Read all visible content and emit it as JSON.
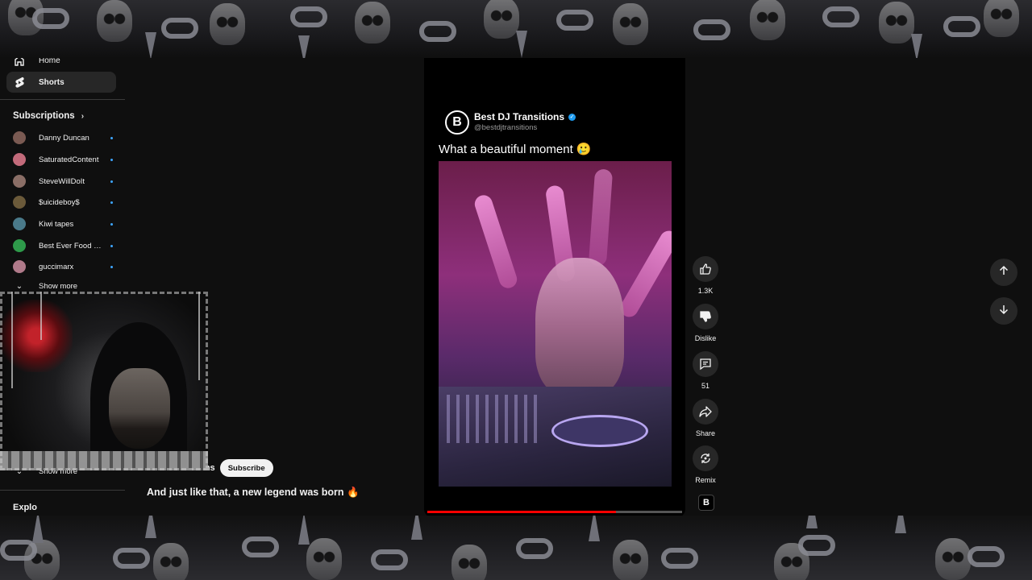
{
  "sidebar": {
    "nav": [
      {
        "label": "Home",
        "icon": "home-icon",
        "active": false
      },
      {
        "label": "Shorts",
        "icon": "shorts-icon",
        "active": true
      }
    ],
    "subscriptions_title": "Subscriptions",
    "subscriptions": [
      {
        "name": "Danny Duncan",
        "avatar_color": "#7a5a52"
      },
      {
        "name": "SaturatedContent",
        "avatar_color": "#c26a7a"
      },
      {
        "name": "SteveWillDoIt",
        "avatar_color": "#8a6e66"
      },
      {
        "name": "$uicideboy$",
        "avatar_color": "#6b5a3a"
      },
      {
        "name": "Kiwi tapes",
        "avatar_color": "#4a7a8a"
      },
      {
        "name": "Best Ever Food R...",
        "avatar_color": "#2e9a4a"
      },
      {
        "name": "guccimarx",
        "avatar_color": "#b07a8a"
      }
    ],
    "show_more_1": "Show more",
    "show_more_2": "Show more",
    "explore_title": "Explo"
  },
  "short": {
    "channel_partial": "Transitions",
    "subscribe_label": "Subscribe",
    "caption": "And just like that, a new legend was born 🔥",
    "post": {
      "logo_letter": "B",
      "name": "Best DJ Transitions",
      "handle": "@bestdjtransitions",
      "text": "What a beautiful moment 🥲"
    },
    "progress_percent": 74
  },
  "actions": {
    "like": {
      "label": "1.3K",
      "icon": "thumbs-up-icon"
    },
    "dislike": {
      "label": "Dislike",
      "icon": "thumbs-down-icon"
    },
    "comments": {
      "label": "51",
      "icon": "comment-icon"
    },
    "share": {
      "label": "Share",
      "icon": "share-icon"
    },
    "remix": {
      "label": "Remix",
      "icon": "remix-icon"
    },
    "channel_thumb": "B"
  },
  "navigation": {
    "up_icon": "arrow-up-icon",
    "down_icon": "arrow-down-icon"
  },
  "colors": {
    "background": "#0f0f0f",
    "progress": "#ff0000",
    "subscription_dot": "#3ea6ff",
    "button_bg": "#272727"
  }
}
